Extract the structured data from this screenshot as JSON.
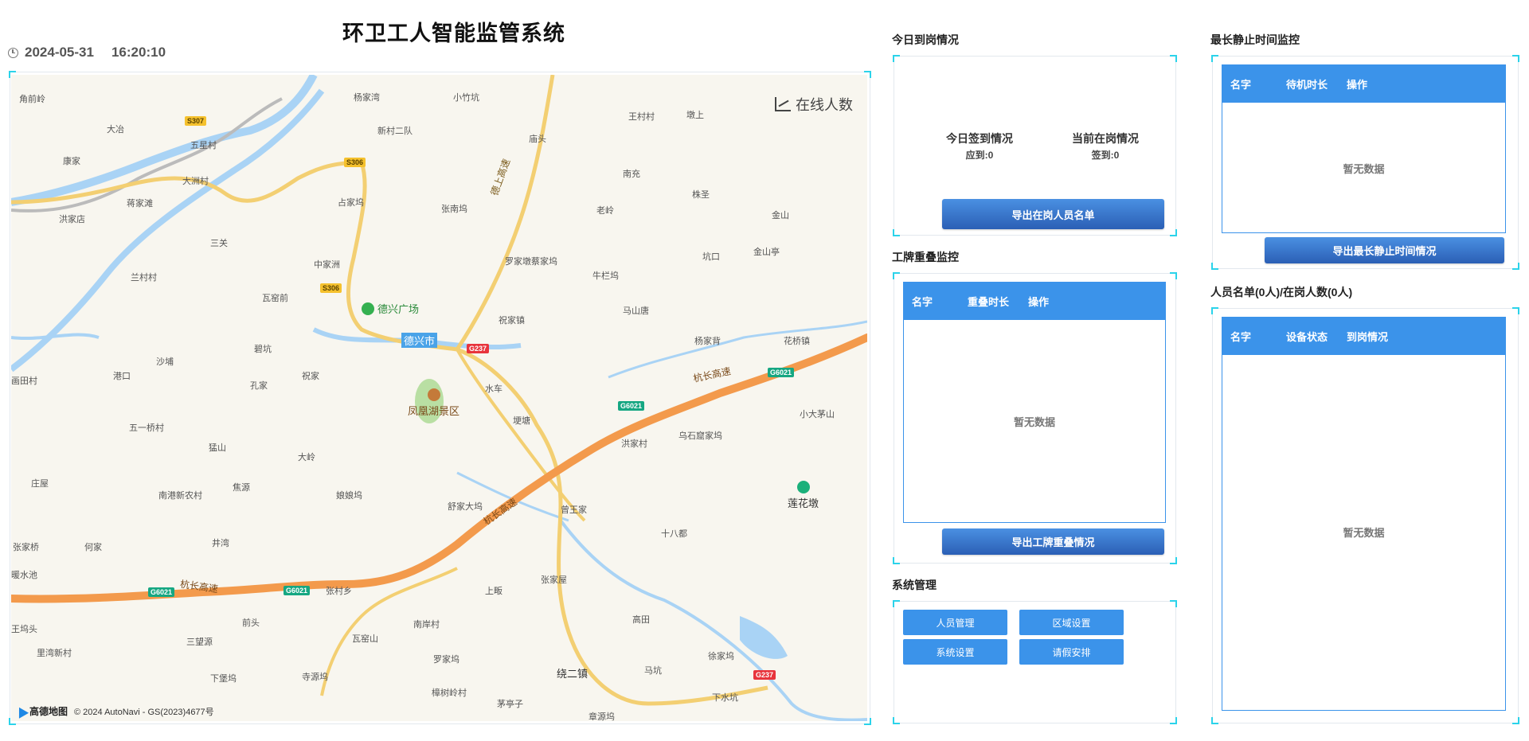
{
  "header": {
    "title": "环卫工人智能监管系统",
    "date": "2024-05-31",
    "time": "16:20:10"
  },
  "map": {
    "online_label": "在线人数",
    "attribution_logo": "高德地图",
    "attribution_text": "© 2024 AutoNavi - GS(2023)4677号",
    "pois": {
      "plaza": "德兴广场",
      "city": "德兴市",
      "scenic": "凤凰湖景区",
      "lianhua": "莲花墩"
    },
    "places": [
      "角前岭",
      "杨家湾",
      "小竹坑",
      "大冶",
      "五星村",
      "新村二队",
      "康家",
      "大洲村",
      "蒋家滩",
      "洪家店",
      "三关",
      "兰村村",
      "中家洲",
      "瓦窑前",
      "碧坑",
      "沙埔",
      "港口",
      "孔家",
      "祝家",
      "五一桥村",
      "猛山",
      "大岭",
      "庄屋",
      "南港新农村",
      "焦源",
      "娘娘坞",
      "何家",
      "张家桥",
      "井湾",
      "舒家大坞",
      "曾王家",
      "水车",
      "埂塘",
      "洪家村",
      "乌石窟家坞",
      "十八都",
      "暖水池",
      "高田",
      "徐家坞",
      "下水坑",
      "绕二镇",
      "马坑",
      "罗家坞",
      "南岸村",
      "瓦窑山",
      "王坞头",
      "寺源坞",
      "下堡坞",
      "里湾新村",
      "三望源",
      "前头",
      "张村乡",
      "上畈",
      "张家屋",
      "樟树岭村",
      "茅亭子",
      "章源坞",
      "王村村",
      "墩上",
      "南充",
      "株圣",
      "老岭",
      "金山",
      "坑口",
      "金山亭",
      "罗家墩蔡家坞",
      "牛栏坞",
      "马山唐",
      "杨家背",
      "花桥镇",
      "小大茅山",
      "画田村",
      "张南坞",
      "占家坞",
      "祝家镇",
      "庙头"
    ],
    "roads": {
      "s307": "S307",
      "s306a": "S306",
      "s306b": "S306",
      "g237a": "G237",
      "g237b": "G237",
      "g6021a": "G6021",
      "g6021b": "G6021",
      "g6021c": "G6021",
      "g6021d": "G6021",
      "expressway1": "杭长高速",
      "expressway2": "杭长高速",
      "expressway3": "杭长高速",
      "g237_road": "德上高速"
    }
  },
  "attendance": {
    "title": "今日到岗情况",
    "signin_label": "今日签到情况",
    "signin_value": "应到:0",
    "onpost_label": "当前在岗情况",
    "onpost_value": "签到:0",
    "export_button": "导出在岗人员名单"
  },
  "badge_overlap": {
    "title": "工牌重叠监控",
    "columns": [
      "名字",
      "重叠时长",
      "操作"
    ],
    "empty_text": "暂无数据",
    "export_button": "导出工牌重叠情况"
  },
  "system": {
    "title": "系统管理",
    "buttons": [
      "人员管理",
      "区域设置",
      "系统设置",
      "请假安排"
    ]
  },
  "idle_monitor": {
    "title": "最长静止时间监控",
    "columns": [
      "名字",
      "待机时长",
      "操作"
    ],
    "empty_text": "暂无数据",
    "export_button": "导出最长静止时间情况"
  },
  "personnel": {
    "title": "人员名单(0人)/在岗人数(0人)",
    "columns": [
      "名字",
      "设备状态",
      "到岗情况"
    ],
    "empty_text": "暂无数据"
  },
  "colors": {
    "accent": "#3b93ea",
    "corner": "#2bd3ea",
    "expressway": "#f39a4c",
    "river": "#a9d3f5"
  }
}
